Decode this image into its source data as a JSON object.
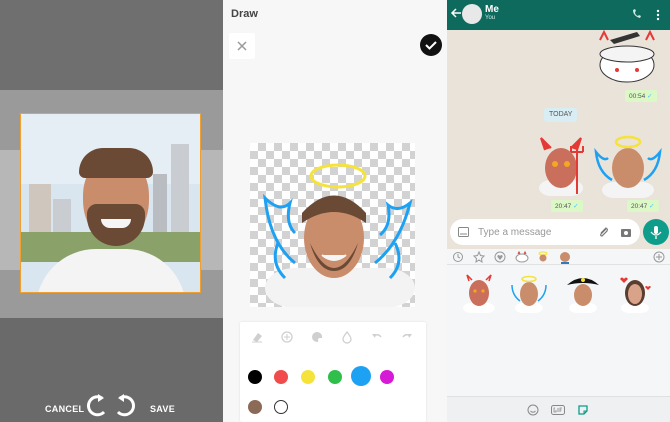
{
  "crop_screen": {
    "cancel_label": "CANCEL",
    "save_label": "SAVE",
    "rotate_left_icon": "rotate-left-icon",
    "rotate_right_icon": "rotate-right-icon",
    "frame_color": "#f0a030"
  },
  "draw_screen": {
    "title": "Draw",
    "close_icon": "close-icon",
    "done_icon": "check-icon",
    "tools": [
      "eraser-icon",
      "emoji-icon",
      "palette-icon",
      "opacity-icon",
      "undo-icon",
      "redo-icon"
    ],
    "colors": [
      "#000000",
      "#f04c4c",
      "#f5e23b",
      "#2fbf4a",
      "#1da1f2",
      "#d61ad6",
      "#8b6a58",
      "#ffffff"
    ],
    "selected_color": "#1da1f2"
  },
  "chat_screen": {
    "contact_name": "Me",
    "contact_subtitle": "You",
    "message_times": [
      "00:54",
      "20:47",
      "20:47"
    ],
    "day_divider": "TODAY",
    "input_placeholder": "Type a message",
    "header_color": "#0d6a5d",
    "tray_tabs": [
      "recent-icon",
      "favorites-icon",
      "heart-icon",
      "sticker-pack-1",
      "sticker-pack-2",
      "sticker-pack-3",
      "add-icon"
    ],
    "tray_bottom_icons": [
      "emoji-icon",
      "gif-icon",
      "sticker-icon"
    ]
  }
}
